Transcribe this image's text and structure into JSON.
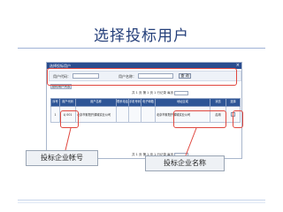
{
  "slide": {
    "title": "选择投标用户"
  },
  "window": {
    "title": "选择投标用户",
    "close_glyph": "×"
  },
  "search": {
    "account_label": "用户代码：",
    "name_label": "用户名称：",
    "query_button": "查 询"
  },
  "tab": {
    "label": "投标用户列表"
  },
  "pager": {
    "top_text": "共 1 页  第 1 页 1 行记录",
    "bottom_text": "共 1 页  第 1 页 1 行记录",
    "page_label": "每页"
  },
  "table": {
    "headers": [
      "序号",
      "用户代码",
      "用户名称",
      "联系电话",
      "手机号码",
      "电子邮箱",
      "地址区域",
      "状态",
      "选择"
    ],
    "rows": [
      {
        "no": "1",
        "code": "LJ 001",
        "name": "北京市紫阳开源城实业公司",
        "tel": "",
        "mobile": "",
        "email": "",
        "address": "北京市紫阳开源城实业公司",
        "status": "启用",
        "select": ""
      }
    ]
  },
  "callouts": {
    "account": "投标企业帐号",
    "name": "投标企业名称"
  },
  "colors": {
    "title": "#243f7a",
    "header": "#2e5596",
    "highlight": "#e0473f"
  }
}
